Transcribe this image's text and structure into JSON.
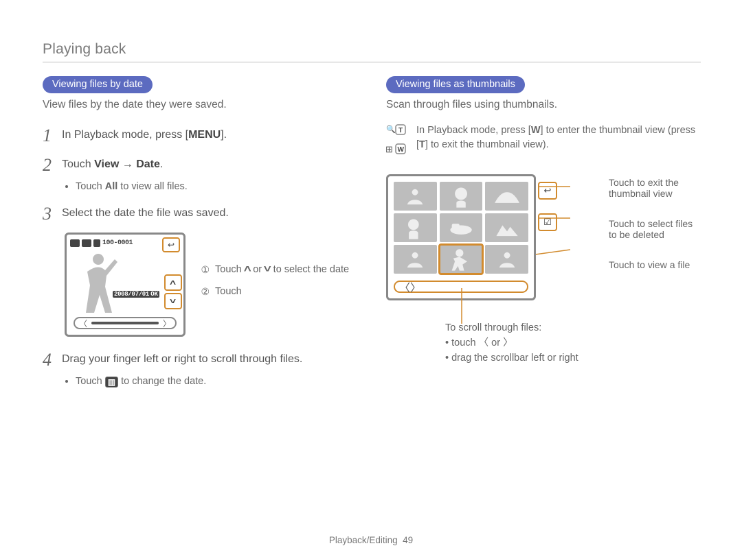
{
  "header": {
    "title": "Playing back"
  },
  "footer": {
    "section": "Playback/Editing",
    "page": "49"
  },
  "left": {
    "pill": "Viewing files by date",
    "intro": "View files by the date they were saved.",
    "step1_pre": "In Playback mode, press [",
    "step1_bold": "MENU",
    "step1_post": "].",
    "step2_pre": "Touch ",
    "step2_b1": "View",
    "step2_arrow": " → ",
    "step2_b2": "Date",
    "step2_post": ".",
    "bullet_b": "All",
    "bullet_pre": "Touch ",
    "bullet_post": " to view all files.",
    "step3": "Select the date the file was saved.",
    "file_label": "100-0001",
    "date_label": "2008/07/01",
    "ok_label": "OK",
    "callout1_pre": "Touch ",
    "callout1_mid": " or ",
    "callout1_post": " to select the date",
    "callout2": "Touch",
    "step4": "Drag your finger left or right to scroll through files.",
    "bullet4_pre": "Touch ",
    "bullet4_post": " to change the date."
  },
  "right": {
    "pill": "Viewing files as thumbnails",
    "intro": "Scan through files using thumbnails.",
    "twnote_a": "In Playback mode, press [",
    "twnote_b": "W",
    "twnote_c": "] to enter the thumbnail view (press [",
    "twnote_d": "T",
    "twnote_e": "] to exit the thumbnail view).",
    "lbl1": "Touch to exit the thumbnail view",
    "lbl2": "Touch to select files to be deleted",
    "lbl3": "Touch to view a file",
    "below_title": "To scroll through files:",
    "below_a_pre": "touch ",
    "below_a_mid": " or ",
    "below_b": "drag the scrollbar left or right"
  }
}
